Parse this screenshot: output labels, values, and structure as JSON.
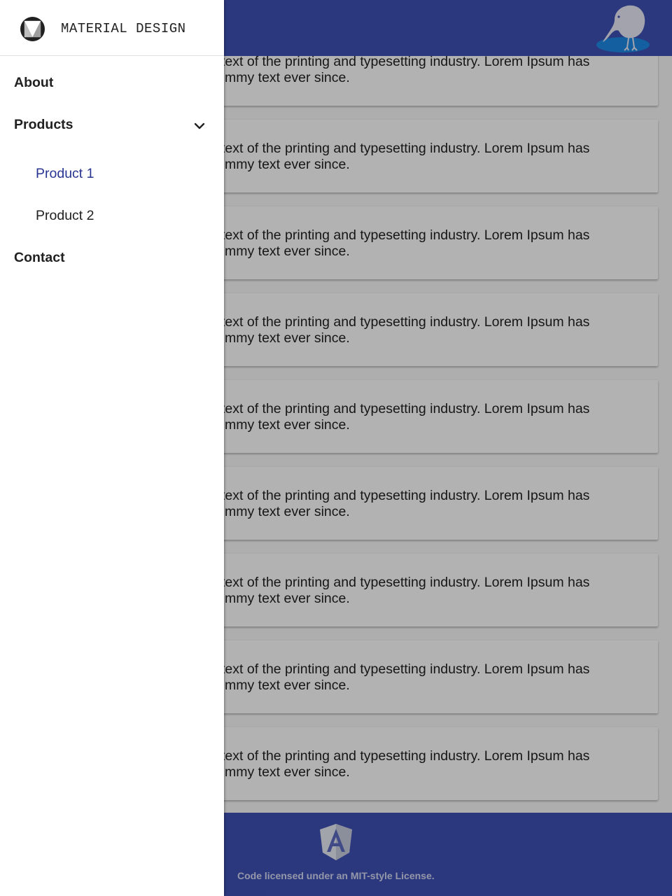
{
  "drawer": {
    "brand": "MATERIAL DESIGN",
    "logo_icon": "material-design-logo-icon",
    "items": [
      {
        "label": "About"
      },
      {
        "label": "Products",
        "expanded": true,
        "icon": "chevron-down-icon",
        "children": [
          {
            "label": "Product 1",
            "active": true
          },
          {
            "label": "Product 2",
            "active": false
          }
        ]
      },
      {
        "label": "Contact"
      }
    ]
  },
  "header": {
    "logo_icon": "kiwi-bird-logo-icon"
  },
  "cards": [
    {
      "line1": "text of the printing and typesetting industry. Lorem Ipsum has",
      "line2": "mmy text ever since."
    },
    {
      "line1": "text of the printing and typesetting industry. Lorem Ipsum has",
      "line2": "mmy text ever since."
    },
    {
      "line1": "text of the printing and typesetting industry. Lorem Ipsum has",
      "line2": "mmy text ever since."
    },
    {
      "line1": "text of the printing and typesetting industry. Lorem Ipsum has",
      "line2": "mmy text ever since."
    },
    {
      "line1": "text of the printing and typesetting industry. Lorem Ipsum has",
      "line2": "mmy text ever since."
    },
    {
      "line1": "text of the printing and typesetting industry. Lorem Ipsum has",
      "line2": "mmy text ever since."
    },
    {
      "line1": "text of the printing and typesetting industry. Lorem Ipsum has",
      "line2": "mmy text ever since."
    },
    {
      "line1": "text of the printing and typesetting industry. Lorem Ipsum has",
      "line2": "mmy text ever since."
    },
    {
      "line1": "text of the printing and typesetting industry. Lorem Ipsum has",
      "line2": "mmy text ever since."
    }
  ],
  "footer": {
    "logo_icon": "angular-logo-icon",
    "license": "Code licensed under an MIT-style License."
  },
  "colors": {
    "primary": "#3f51b5",
    "active_link": "#283593",
    "scrim": "rgba(0,0,0,0.30)"
  }
}
